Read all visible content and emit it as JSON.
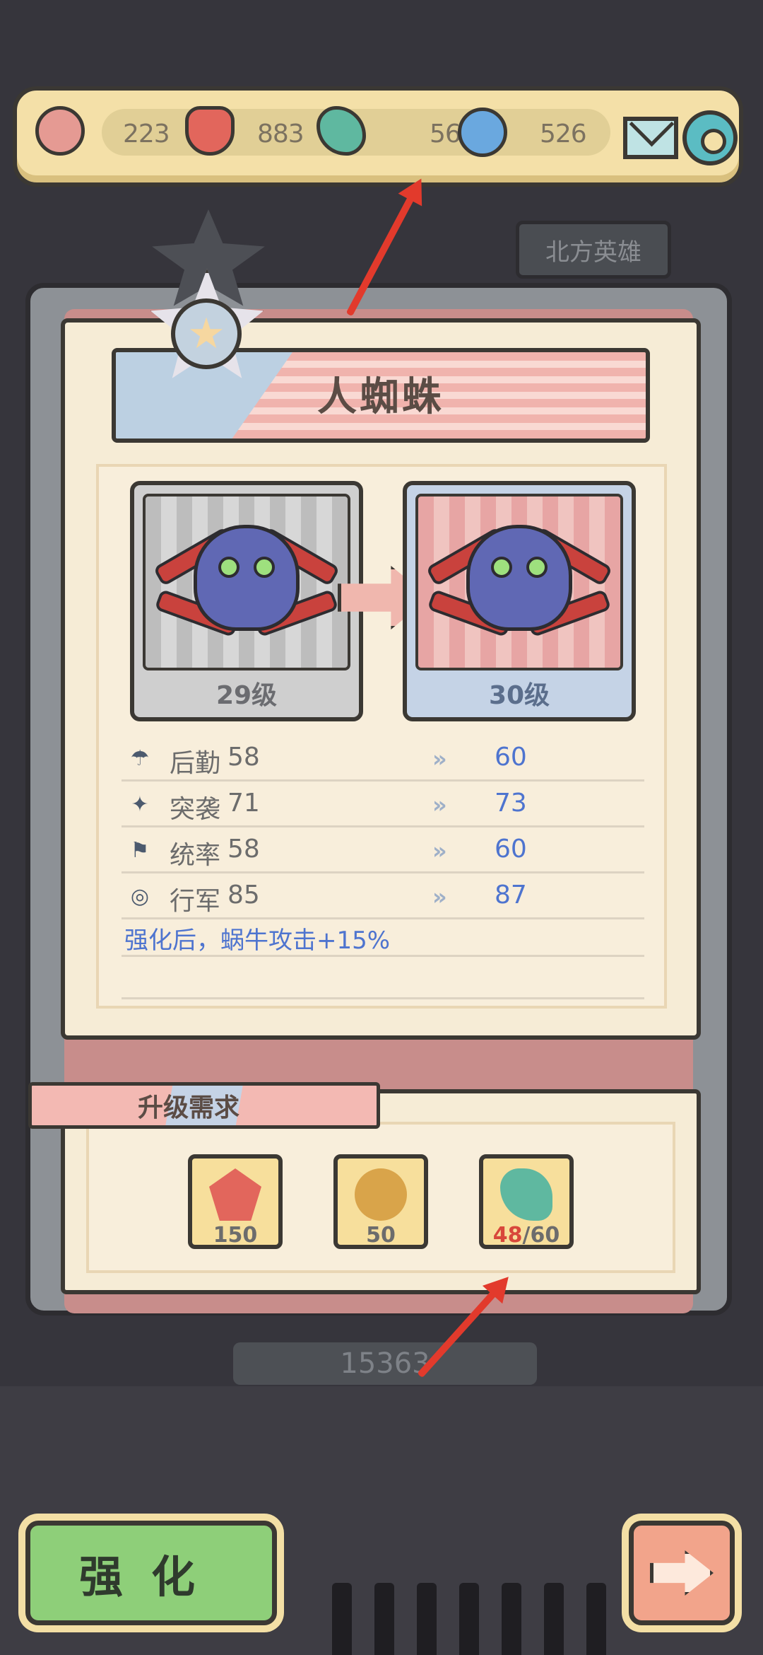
{
  "resources": {
    "res1_value": "223",
    "res2_value": "883",
    "res3_value": "56",
    "res4_value": "526"
  },
  "tab_label": "北方英雄",
  "hero": {
    "name": "人蜘蛛",
    "current_level": "29级",
    "next_level": "30级"
  },
  "stats": [
    {
      "name": "后勤",
      "current": "58",
      "next": "60",
      "icon": "parachute-icon"
    },
    {
      "name": "突袭",
      "current": "71",
      "next": "73",
      "icon": "rifle-icon"
    },
    {
      "name": "统率",
      "current": "58",
      "next": "60",
      "icon": "flag-icon"
    },
    {
      "name": "行军",
      "current": "85",
      "next": "87",
      "icon": "wheel-icon"
    }
  ],
  "bonus_text": "强化后，蜗牛攻击+15%",
  "requirements": {
    "title": "升级需求",
    "items": [
      {
        "count": "150",
        "icon": "crystal-icon"
      },
      {
        "count": "50",
        "icon": "gear-medal-icon"
      },
      {
        "have": "48",
        "need": "/60",
        "icon": "beast-claw-icon"
      }
    ]
  },
  "power_value": "15363",
  "buttons": {
    "strengthen": "强化"
  },
  "colors": {
    "accent_blue": "#4e74cf",
    "warning_red": "#d8473b",
    "button_green": "#8ecf79"
  }
}
